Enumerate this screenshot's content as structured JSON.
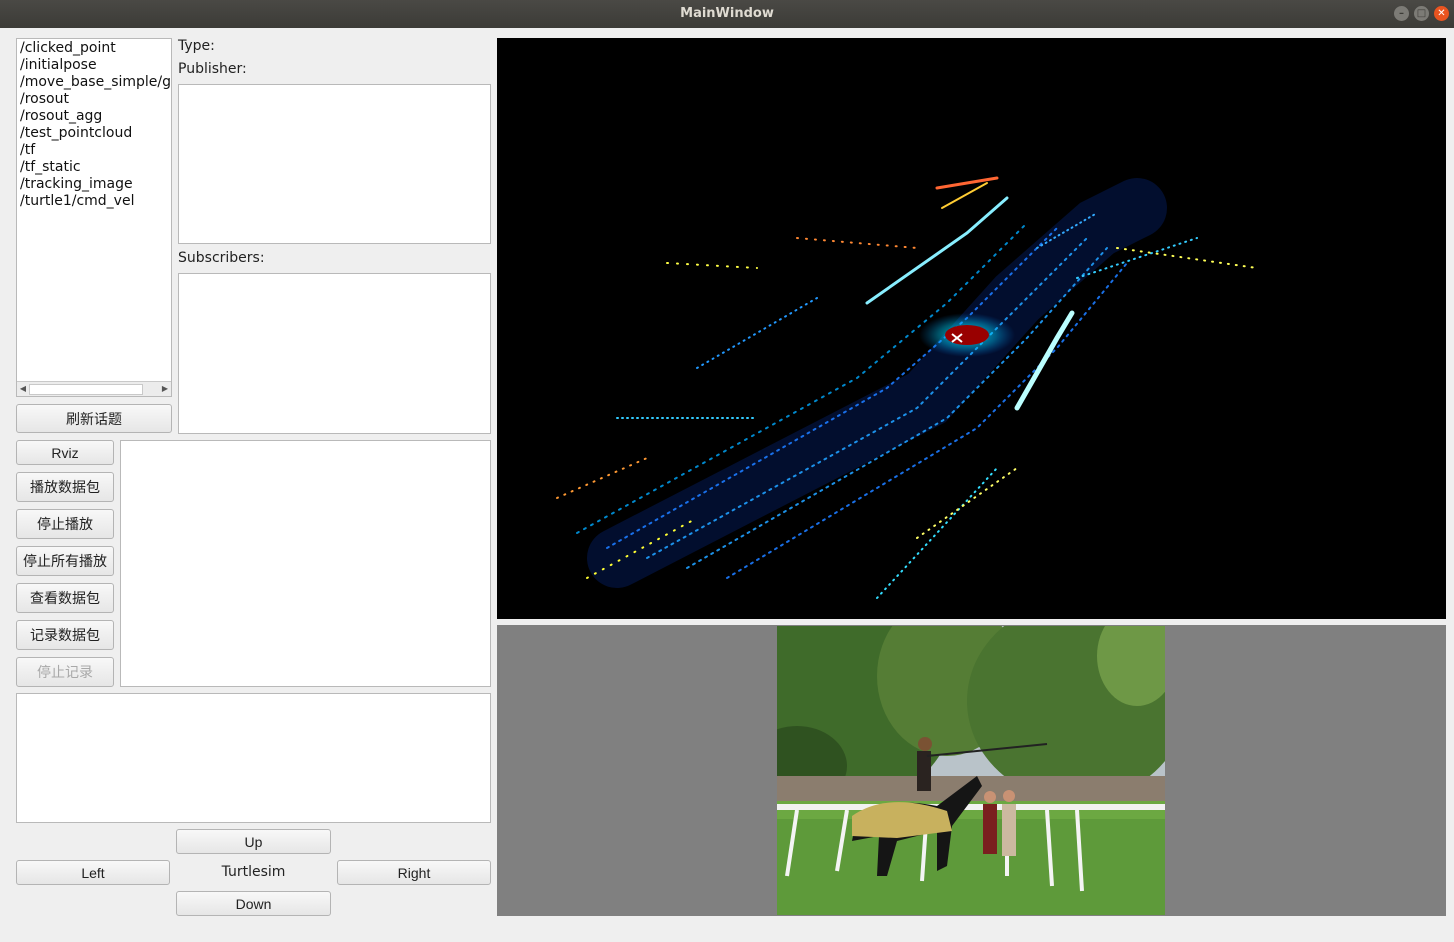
{
  "window": {
    "title": "MainWindow"
  },
  "window_buttons": {
    "minimize": "–",
    "maximize": "□",
    "close": "✕"
  },
  "topics": {
    "items": [
      "/clicked_point",
      "/initialpose",
      "/move_base_simple/goal",
      "/rosout",
      "/rosout_agg",
      "/test_pointcloud",
      "/tf",
      "/tf_static",
      "/tracking_image",
      "/turtle1/cmd_vel"
    ],
    "scroll_left": "◀",
    "scroll_right": "▶"
  },
  "topic_info": {
    "type_label": "Type:",
    "publisher_label": "Publisher:",
    "subscribers_label": "Subscribers:"
  },
  "refresh_button": "刷新话题",
  "controls": {
    "rviz": "Rviz",
    "play_bag": "播放数据包",
    "stop_play": "停止播放",
    "stop_all": "停止所有播放",
    "view_bag": "查看数据包",
    "record_bag": "记录数据包",
    "stop_record": "停止记录"
  },
  "turtlesim": {
    "up": "Up",
    "down": "Down",
    "left": "Left",
    "right": "Right",
    "label": "Turtlesim"
  }
}
